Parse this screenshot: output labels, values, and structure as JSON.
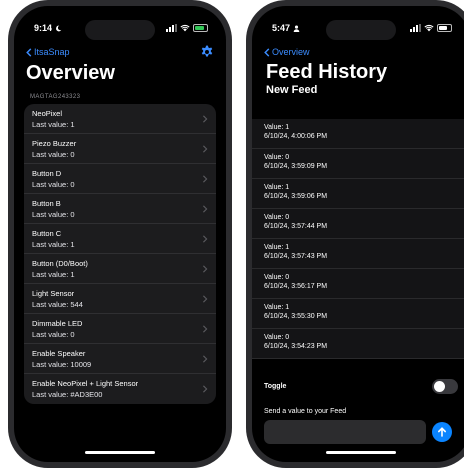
{
  "left_screen": {
    "status": {
      "time": "9:14"
    },
    "nav": {
      "back_label": "ItsaSnap",
      "settings_icon": "gear-icon"
    },
    "title": "Overview",
    "section_header": "MAGTAG243323",
    "items": [
      {
        "name": "NeoPixel",
        "value": "Last value: 1"
      },
      {
        "name": "Piezo Buzzer",
        "value": "Last value: 0"
      },
      {
        "name": "Button D",
        "value": "Last value: 0"
      },
      {
        "name": "Button B",
        "value": "Last value: 0"
      },
      {
        "name": "Button C",
        "value": "Last value: 1"
      },
      {
        "name": "Button (D0/Boot)",
        "value": "Last value: 1"
      },
      {
        "name": "Light Sensor",
        "value": "Last value: 544"
      },
      {
        "name": "Dimmable LED",
        "value": "Last value: 0"
      },
      {
        "name": "Enable Speaker",
        "value": "Last value: 10009"
      },
      {
        "name": "Enable NeoPixel + Light Sensor",
        "value": "Last value: #AD3E00"
      }
    ]
  },
  "right_screen": {
    "status": {
      "time": "5:47"
    },
    "nav": {
      "back_label": "Overview"
    },
    "title": "Feed History",
    "subtitle": "New Feed",
    "history": [
      {
        "value": "Value: 1",
        "timestamp": "6/10/24, 4:00:06 PM"
      },
      {
        "value": "Value: 0",
        "timestamp": "6/10/24, 3:59:09 PM"
      },
      {
        "value": "Value: 1",
        "timestamp": "6/10/24, 3:59:06 PM"
      },
      {
        "value": "Value: 0",
        "timestamp": "6/10/24, 3:57:44 PM"
      },
      {
        "value": "Value: 1",
        "timestamp": "6/10/24, 3:57:43 PM"
      },
      {
        "value": "Value: 0",
        "timestamp": "6/10/24, 3:56:17 PM"
      },
      {
        "value": "Value: 1",
        "timestamp": "6/10/24, 3:55:30 PM"
      },
      {
        "value": "Value: 0",
        "timestamp": "6/10/24, 3:54:23 PM"
      }
    ],
    "toggle_label": "Toggle",
    "toggle_on": false,
    "send_label": "Send a value to your Feed",
    "send_input_value": "",
    "send_icon": "arrow-up-icon"
  },
  "colors": {
    "accent": "#0a84ff",
    "background": "#000000",
    "row_background": "#1c1c1e",
    "left_battery": "#34c759",
    "right_battery": "#ffffff"
  }
}
